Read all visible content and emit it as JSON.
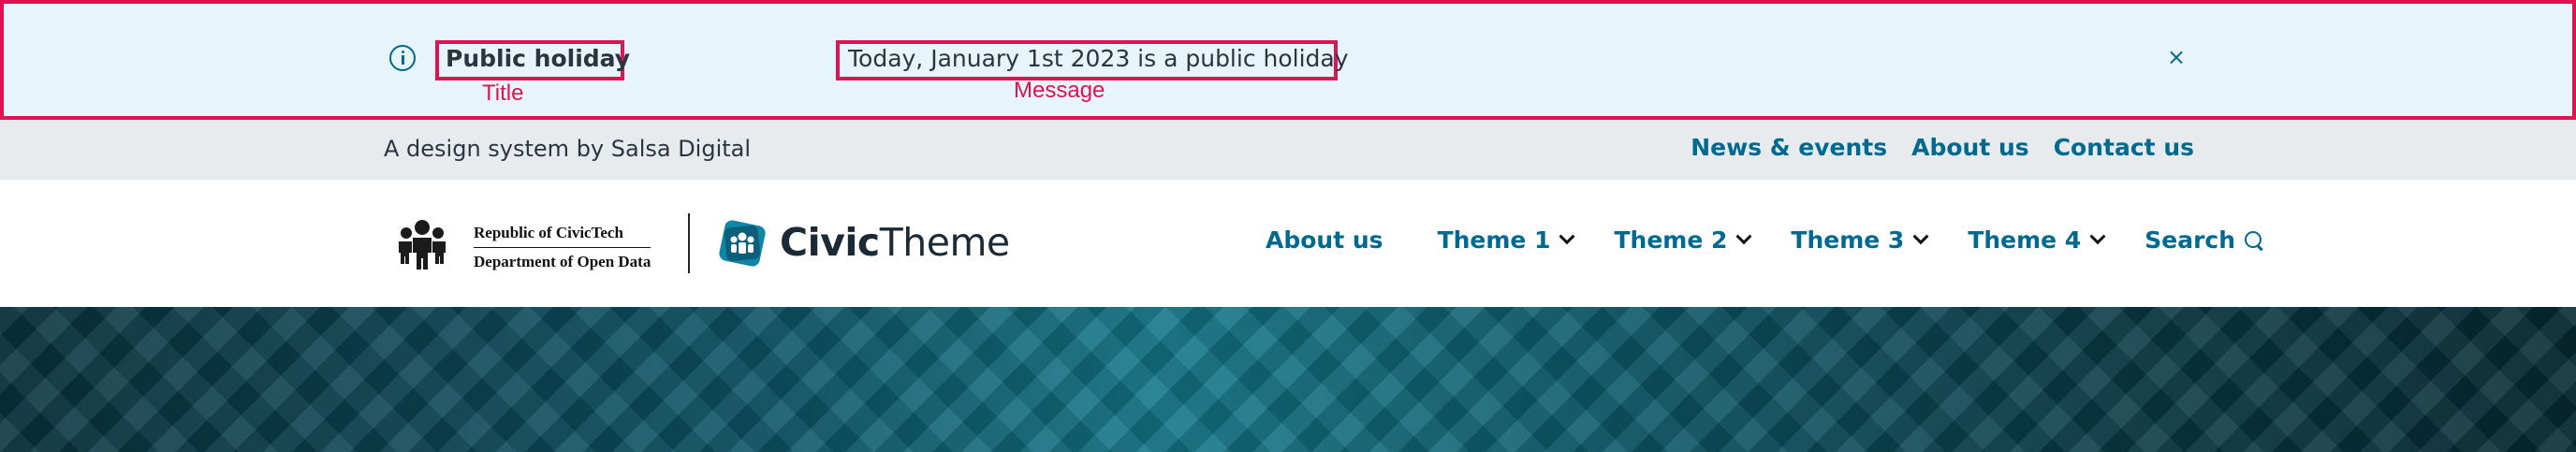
{
  "alert": {
    "title": "Public holiday",
    "message": "Today, January 1st 2023 is a public holiday",
    "annotation_title": "Title",
    "annotation_message": "Message",
    "close_glyph": "×",
    "info_icon": "info-icon",
    "accent_color": "#e0124f",
    "background_color": "#e7f4fc"
  },
  "topbar": {
    "tagline": "A design system by Salsa Digital",
    "links": [
      {
        "label": "News & events"
      },
      {
        "label": "About us"
      },
      {
        "label": "Contact us"
      }
    ]
  },
  "header": {
    "gov_logo_line1": "Republic of CivicTech",
    "gov_logo_line2": "Department of Open Data",
    "brand_bold": "Civic",
    "brand_regular": "Theme",
    "nav": [
      {
        "label": "About us",
        "dropdown": false
      },
      {
        "label": "Theme 1",
        "dropdown": true
      },
      {
        "label": "Theme 2",
        "dropdown": true
      },
      {
        "label": "Theme 3",
        "dropdown": true
      },
      {
        "label": "Theme 4",
        "dropdown": true
      },
      {
        "label": "Search",
        "dropdown": false,
        "icon": "search-icon"
      }
    ],
    "link_color": "#00698f"
  }
}
